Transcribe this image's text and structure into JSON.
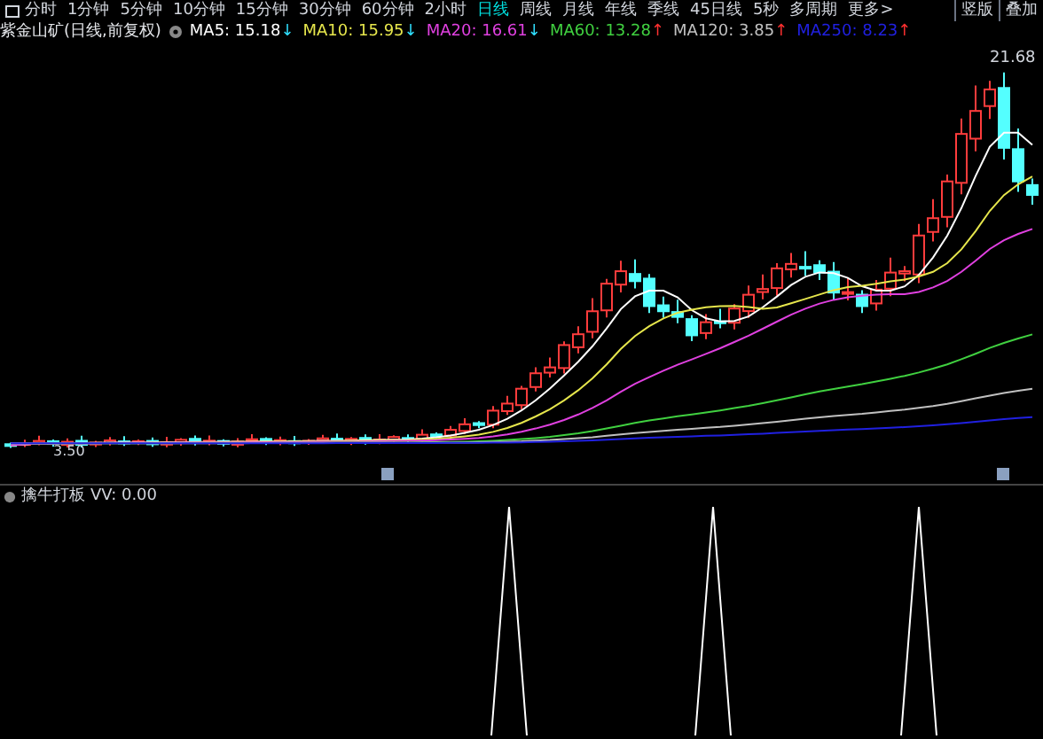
{
  "toolbar": {
    "tabs": [
      {
        "label": "分时",
        "selected": false
      },
      {
        "label": "1分钟",
        "selected": false
      },
      {
        "label": "5分钟",
        "selected": false
      },
      {
        "label": "10分钟",
        "selected": false
      },
      {
        "label": "15分钟",
        "selected": false
      },
      {
        "label": "30分钟",
        "selected": false
      },
      {
        "label": "60分钟",
        "selected": false
      },
      {
        "label": "2小时",
        "selected": false
      },
      {
        "label": "日线",
        "selected": true
      },
      {
        "label": "周线",
        "selected": false
      },
      {
        "label": "月线",
        "selected": false
      },
      {
        "label": "年线",
        "selected": false
      },
      {
        "label": "季线",
        "selected": false
      },
      {
        "label": "45日线",
        "selected": false
      },
      {
        "label": "5秒",
        "selected": false
      },
      {
        "label": "多周期",
        "selected": false
      },
      {
        "label": "更多>",
        "selected": false
      }
    ],
    "right_buttons": [
      "竖版",
      "叠加"
    ]
  },
  "chart_header": {
    "title": "紫金山矿(日线,前复权)",
    "moving_averages": [
      {
        "name": "MA5:",
        "value": "15.18",
        "arrow": {
          "text": "↓",
          "color": "#30e0ff"
        },
        "color": "#ffffff"
      },
      {
        "name": "MA10:",
        "value": "15.95",
        "arrow": {
          "text": "↓",
          "color": "#30e0ff"
        },
        "color": "#e6e64c"
      },
      {
        "name": "MA20:",
        "value": "16.61",
        "arrow": {
          "text": "↓",
          "color": "#30e0ff"
        },
        "color": "#e040e0"
      },
      {
        "name": "MA60:",
        "value": "13.28",
        "arrow": {
          "text": "↑",
          "color": "#ff3030"
        },
        "color": "#40d040"
      },
      {
        "name": "MA120:",
        "value": "3.85",
        "arrow": {
          "text": "↑",
          "color": "#ff3030"
        },
        "color": "#c0c0c0"
      },
      {
        "name": "MA250:",
        "value": "8.23",
        "arrow": {
          "text": "↑",
          "color": "#ff3030"
        },
        "color": "#2020e0"
      }
    ]
  },
  "price_labels": {
    "high": "21.68",
    "low": "3.50"
  },
  "indicator": {
    "name": "擒牛打板",
    "value": "VV: 0.00"
  }
}
